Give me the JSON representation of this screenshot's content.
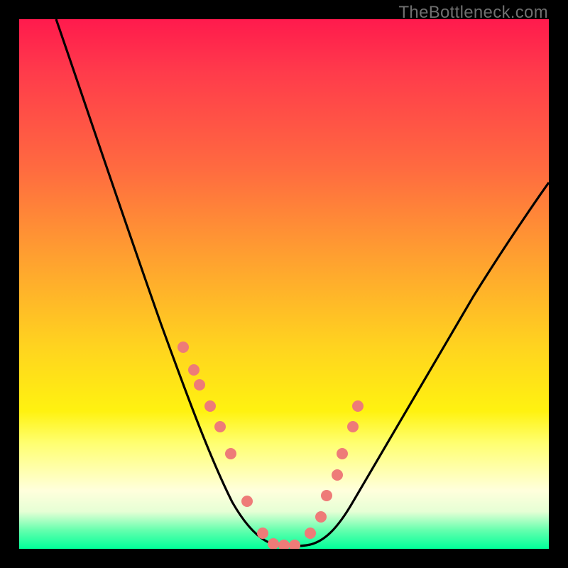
{
  "watermark": "TheBottleneck.com",
  "colors": {
    "frame": "#000000",
    "curve_stroke": "#000000",
    "marker_fill": "#ee7b78",
    "marker_stroke": "#c85a57",
    "gradient_top": "#ff1a4d",
    "gradient_bottom": "#00ff99"
  },
  "chart_data": {
    "type": "line",
    "title": "",
    "xlabel": "",
    "ylabel": "",
    "xlim": [
      0,
      100
    ],
    "ylim": [
      0,
      100
    ],
    "grid": false,
    "legend": false,
    "curve_description": "Single V-shaped curve: falls from upper-left to a flat minimum near the center-bottom, then rises toward the upper-right (slightly lower than the left peak).",
    "series": [
      {
        "name": "bottleneck-curve",
        "x": [
          7,
          10,
          15,
          20,
          25,
          28,
          31,
          34,
          37,
          40,
          42,
          44,
          46,
          48,
          50,
          52,
          54,
          56,
          58,
          61,
          64,
          67,
          70,
          75,
          80,
          85,
          90,
          95,
          100
        ],
        "y": [
          100,
          92,
          80,
          67,
          54,
          46,
          39,
          32,
          25,
          18,
          13,
          9,
          5,
          2,
          1,
          1,
          2,
          4,
          7,
          11,
          16,
          21,
          27,
          35,
          43,
          50,
          57,
          63,
          69
        ]
      }
    ],
    "markers": {
      "name": "highlight-points",
      "x": [
        31,
        33,
        34,
        36,
        38,
        40,
        43,
        46,
        48,
        50,
        52,
        55,
        57,
        58,
        60,
        61,
        63,
        64
      ],
      "y": [
        38,
        34,
        31,
        27,
        23,
        18,
        9,
        3,
        1,
        1,
        1,
        3,
        6,
        10,
        14,
        18,
        23,
        27
      ]
    }
  }
}
